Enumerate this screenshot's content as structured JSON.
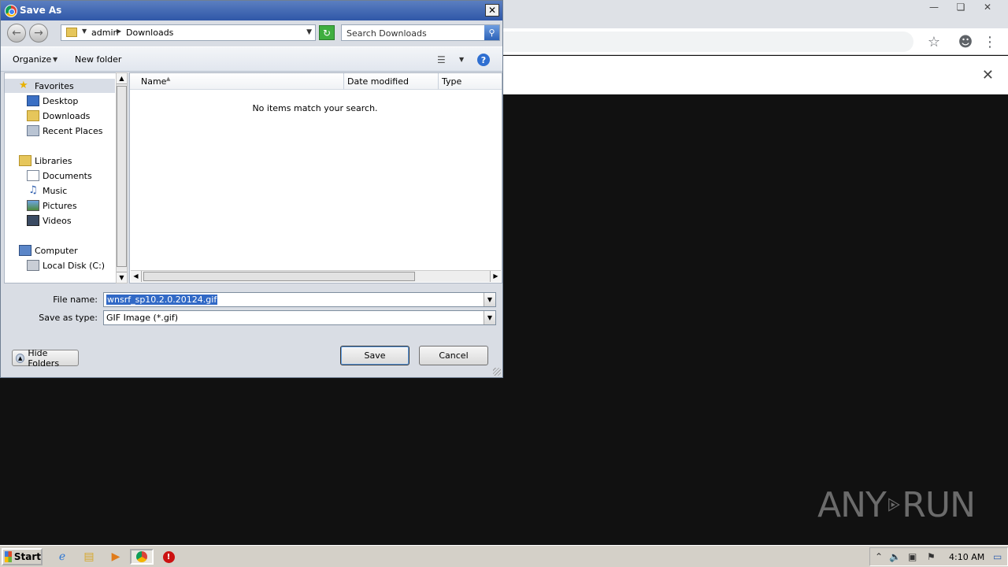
{
  "dialog": {
    "title": "Save As",
    "breadcrumb": [
      "admin",
      "Downloads"
    ],
    "search_placeholder": "Search Downloads",
    "toolbar": {
      "organize": "Organize",
      "new_folder": "New folder"
    },
    "nav": {
      "favorites": "Favorites",
      "favorites_items": [
        "Desktop",
        "Downloads",
        "Recent Places"
      ],
      "libraries": "Libraries",
      "libraries_items": [
        "Documents",
        "Music",
        "Pictures",
        "Videos"
      ],
      "computer": "Computer",
      "computer_items": [
        "Local Disk (C:)"
      ]
    },
    "columns": [
      "Name",
      "Date modified",
      "Type"
    ],
    "empty_message": "No items match your search.",
    "file_name_label": "File name:",
    "file_name_value": "wnsrf_sp10.2.0.20124.gif",
    "save_type_label": "Save as type:",
    "save_type_value": "GIF Image (*.gif)",
    "save_button": "Save",
    "cancel_button": "Cancel",
    "hide_folders": "Hide Folders"
  },
  "taskbar": {
    "start": "Start",
    "clock": "4:10 AM"
  },
  "watermark": {
    "left": "ANY",
    "right": "RUN"
  }
}
